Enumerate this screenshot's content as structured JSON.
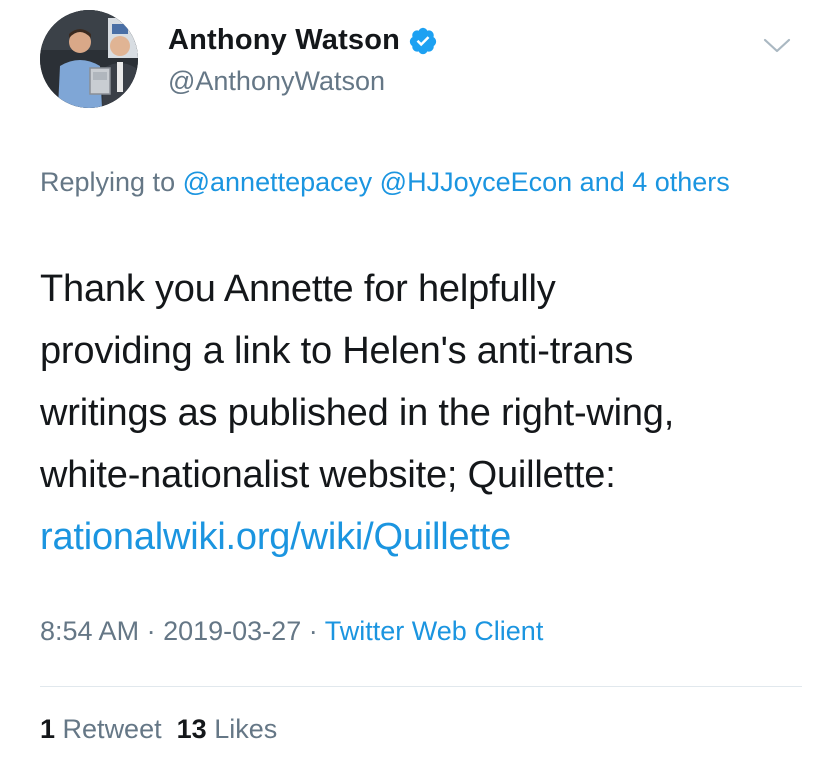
{
  "author": {
    "display_name": "Anthony Watson",
    "handle": "@AnthonyWatson",
    "verified": true
  },
  "reply_context": {
    "prefix": "Replying to",
    "mention_1": "@annettepacey",
    "mention_2": "@HJJoyceEcon",
    "others": "and 4 others"
  },
  "tweet": {
    "line_1": "Thank you Annette for helpfully",
    "line_2": "providing a link to Helen's anti-trans",
    "line_3": "writings as published in the right-wing,",
    "line_4": "white-nationalist website; Quillette:",
    "link": "rationalwiki.org/wiki/Quillette"
  },
  "meta": {
    "time": "8:54 AM",
    "date": "2019-03-27",
    "separator": "·",
    "source": "Twitter Web Client"
  },
  "stats": {
    "retweet_count": "1",
    "retweet_label": "Retweet",
    "like_count": "13",
    "like_label": "Likes"
  },
  "colors": {
    "link_blue": "#1b95e0",
    "secondary_gray": "#657786",
    "text_dark": "#14171a",
    "divider": "#e1e8ed"
  },
  "icons": {
    "verified": "verified-badge-icon",
    "menu": "chevron-down-icon"
  }
}
